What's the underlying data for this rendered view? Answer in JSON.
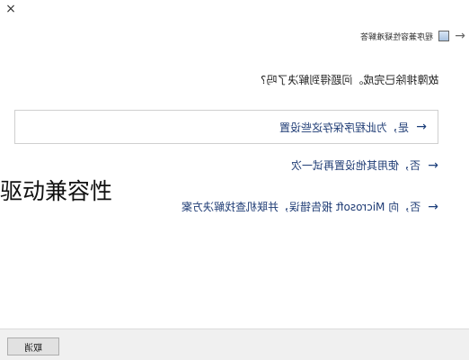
{
  "window": {
    "title": "程序兼容性疑难解答",
    "close_glyph": "×",
    "back_glyph": "→"
  },
  "prompt": {
    "question": "故障排除已完成。问题得到解决了吗?"
  },
  "options": [
    {
      "label": "是，为此程序保存这些设置",
      "arrow": "→"
    },
    {
      "label": "否，使用其他设置再试一次",
      "arrow": "→"
    },
    {
      "label": "否，向 Microsoft 报告错误，并联机查找解决方案",
      "arrow": "→"
    }
  ],
  "overlay": {
    "text": "驱动兼容性"
  },
  "footer": {
    "cancel_label": "取消"
  },
  "colors": {
    "option_text": "#1f3c75",
    "footer_bg": "#f0f0f0"
  },
  "icons": {
    "close": "close-icon",
    "back": "back-arrow-icon",
    "app": "app-icon",
    "option_arrow": "arrow-right-icon"
  }
}
